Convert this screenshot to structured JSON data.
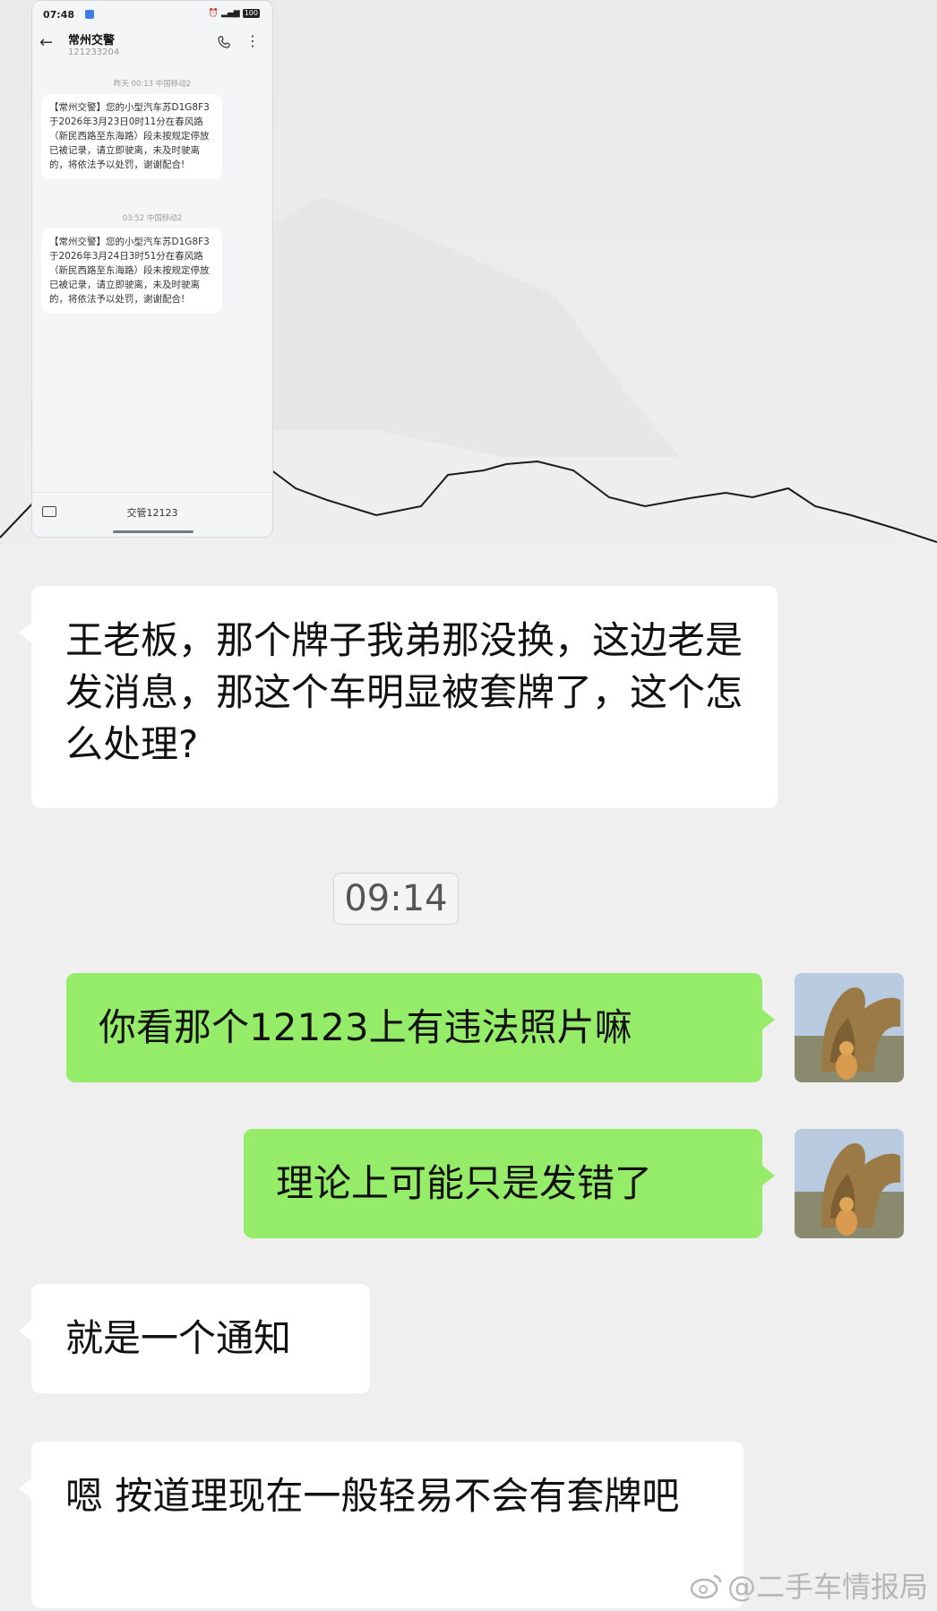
{
  "embedded_screenshot": {
    "status_time": "07:48",
    "status_battery": "100",
    "contact_name": "常州交警",
    "contact_number": "121233204",
    "messages": [
      {
        "stamp": "昨天 00:13 中国移动2",
        "text": "【常州交警】您的小型汽车苏D1G8F3于2026年3月23日0时11分在春风路（新民西路至东海路）段未按规定停放已被记录，请立即驶离，未及时驶离的，将依法予以处罚，谢谢配合!"
      },
      {
        "stamp": "03:52 中国移动2",
        "text": "【常州交警】您的小型汽车苏D1G8F3于2026年3月24日3时51分在春风路（新民西路至东海路）段未按规定停放已被记录，请立即驶离，未及时驶离的，将依法予以处罚，谢谢配合!"
      }
    ],
    "input_label": "交管12123"
  },
  "chat": {
    "msg1": "王老板，那个牌子我弟那没换，这边老是发消息，那这个车明显被套牌了，这个怎么处理?",
    "timestamp": "09:14",
    "msg2": "你看那个12123上有违法照片嘛",
    "msg3": "理论上可能只是发错了",
    "msg4": "就是一个通知",
    "msg5": "嗯 按道理现在一般轻易不会有套牌吧"
  },
  "watermark": "@二手车情报局",
  "colors": {
    "sent_bubble": "#95ec69",
    "received_bubble": "#ffffff",
    "background": "#efefef"
  }
}
